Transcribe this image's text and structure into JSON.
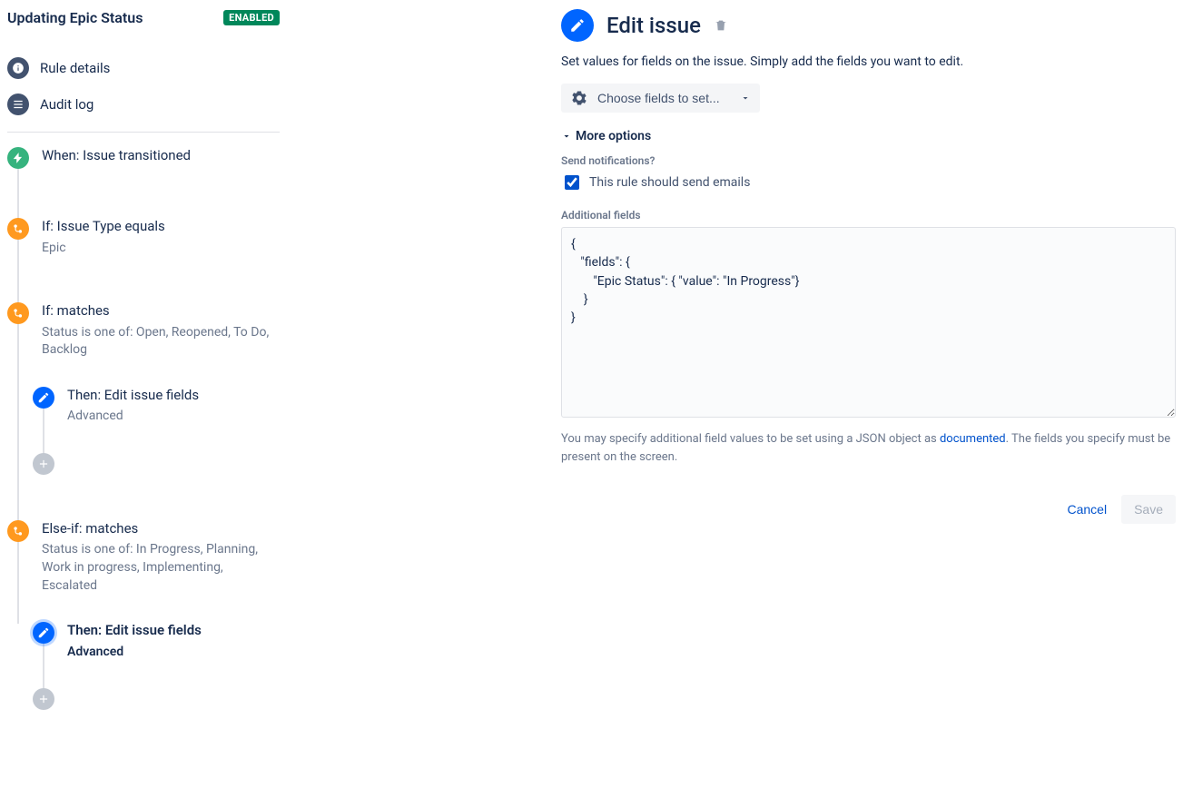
{
  "sidebar": {
    "title": "Updating Epic Status",
    "status_lozenge": "ENABLED",
    "nav": {
      "details": "Rule details",
      "audit": "Audit log"
    }
  },
  "flow": {
    "trigger": {
      "title": "When: Issue transitioned"
    },
    "cond1": {
      "title": "If: Issue Type equals",
      "sub": "Epic"
    },
    "cond2": {
      "title": "If: matches",
      "sub": "Status is one of: Open, Reopened, To Do, Backlog"
    },
    "action1": {
      "title": "Then: Edit issue fields",
      "sub": "Advanced"
    },
    "cond3": {
      "title": "Else-if: matches",
      "sub": "Status is one of: In Progress, Planning, Work in progress, Implementing, Escalated"
    },
    "action2": {
      "title": "Then: Edit issue fields",
      "sub": "Advanced"
    }
  },
  "panel": {
    "title": "Edit issue",
    "description": "Set values for fields on the issue. Simply add the fields you want to edit.",
    "choose_label": "Choose fields to set...",
    "more_options_label": "More options",
    "send_notifications_label": "Send notifications?",
    "checkbox_label": "This rule should send emails",
    "additional_fields_label": "Additional fields",
    "textarea_value": "{\n   \"fields\": {\n       \"Epic Status\": { \"value\": \"In Progress\"}\n    }\n}",
    "helper_pre": "You may specify additional field values to be set using a JSON object as ",
    "helper_link": "documented",
    "helper_post": ". The fields you specify must be present on the screen.",
    "cancel": "Cancel",
    "save": "Save"
  }
}
